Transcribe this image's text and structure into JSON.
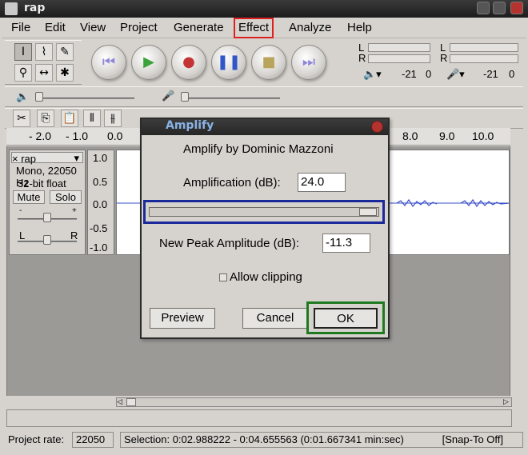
{
  "window": {
    "title": "rap"
  },
  "menu": {
    "items": [
      {
        "label": "File"
      },
      {
        "label": "Edit"
      },
      {
        "label": "View"
      },
      {
        "label": "Project"
      },
      {
        "label": "Generate"
      },
      {
        "label": "Effect"
      },
      {
        "label": "Analyze"
      },
      {
        "label": "Help"
      }
    ],
    "highlight_color": "#e02020"
  },
  "meters": {
    "playback": {
      "l": "L",
      "r": "R",
      "level": "-21",
      "value": "0"
    },
    "record": {
      "l": "L",
      "r": "R",
      "level": "-21",
      "value": "0"
    }
  },
  "ruler": {
    "ticks": [
      "- 2.0",
      "- 1.0",
      "0.0",
      "8.0",
      "9.0",
      "10.0"
    ]
  },
  "track": {
    "name": "rap",
    "format": "Mono, 22050 Hz",
    "bitdepth": "32-bit float",
    "mute": "Mute",
    "solo": "Solo",
    "pan_l": "L",
    "pan_r": "R",
    "gain_minus": "-",
    "gain_plus": "+",
    "close": "×",
    "vruler": [
      "1.0",
      "0.5",
      "0.0",
      "-0.5",
      "-1.0"
    ]
  },
  "dialog": {
    "title": "Amplify",
    "heading": "Amplify by Dominic Mazzoni",
    "amplification_label": "Amplification (dB):",
    "amplification_value": "24.0",
    "peak_label": "New Peak Amplitude (dB):",
    "peak_value": "-11.3",
    "allow_clipping_label": "Allow clipping",
    "preview_label": "Preview",
    "cancel_label": "Cancel",
    "ok_label": "OK",
    "slider_outline_color": "#1a2a9a",
    "ok_outline_color": "#1f7a1f"
  },
  "status": {
    "project_rate_label": "Project rate:",
    "project_rate_value": "22050",
    "selection": "Selection: 0:02.988222 - 0:04.655563 (0:01.667341 min:sec)",
    "snap": "[Snap-To Off]"
  }
}
